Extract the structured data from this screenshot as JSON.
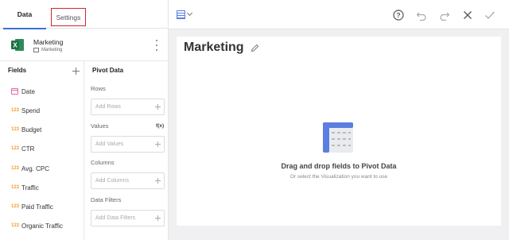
{
  "tabs": {
    "data": "Data",
    "settings": "Settings"
  },
  "datasource": {
    "name": "Marketing",
    "sheet": "Marketing",
    "icon": "excel-icon"
  },
  "fields": {
    "header": "Fields",
    "items": [
      {
        "type": "date",
        "icon": "calendar-icon",
        "label": "Date"
      },
      {
        "type": "123",
        "label": "Spend"
      },
      {
        "type": "123",
        "label": "Budget"
      },
      {
        "type": "123",
        "label": "CTR"
      },
      {
        "type": "123",
        "label": "Avg. CPC"
      },
      {
        "type": "123",
        "label": "Traffic"
      },
      {
        "type": "123",
        "label": "Paid Traffic"
      },
      {
        "type": "123",
        "label": "Organic Traffic"
      }
    ]
  },
  "pivot": {
    "header": "Pivot Data",
    "rows_label": "Rows",
    "rows_placeholder": "Add Rows",
    "values_label": "Values",
    "values_fx": "f(x)",
    "values_placeholder": "Add Values",
    "columns_label": "Columns",
    "columns_placeholder": "Add Columns",
    "filters_label": "Data Filters",
    "filters_placeholder": "Add Data Filters"
  },
  "toolbar": {
    "icons": [
      "table-visualization-icon",
      "help-icon",
      "undo-icon",
      "redo-icon",
      "close-icon",
      "check-icon"
    ]
  },
  "canvas": {
    "title": "Marketing",
    "empty_title": "Drag and drop fields to Pivot Data",
    "empty_subtitle": "Or select the Visualization you want to use"
  },
  "colors": {
    "accent": "#3a6fd8",
    "highlight": "#d0262d",
    "excel": "#1e7145",
    "number_type": "#f0a030",
    "date_type": "#e06aa8"
  }
}
